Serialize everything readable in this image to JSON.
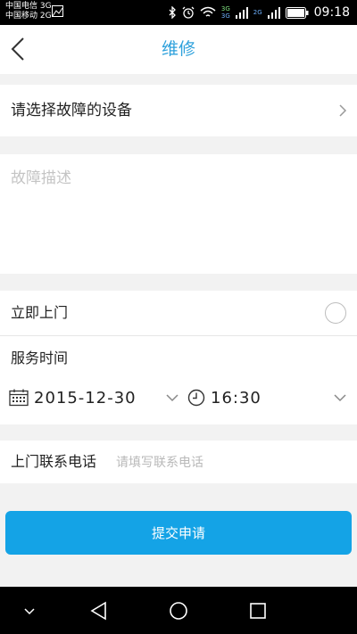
{
  "status_bar": {
    "carrier1": "中国电信 3G",
    "carrier2": "中国移动 2G",
    "net1": "3G",
    "net2": "2G",
    "time": "09:18"
  },
  "header": {
    "title": "维修"
  },
  "device": {
    "label": "请选择故障的设备"
  },
  "description": {
    "placeholder": "故障描述"
  },
  "schedule": {
    "immediate_label": "立即上门",
    "service_time_label": "服务时间",
    "date": "2015-12-30",
    "time": "16:30"
  },
  "contact": {
    "label": "上门联系电话",
    "placeholder": "请填写联系电话"
  },
  "submit_label": "提交申请",
  "colors": {
    "accent": "#2ea1dc",
    "button": "#14a3e6",
    "background": "#f2f2f2"
  }
}
